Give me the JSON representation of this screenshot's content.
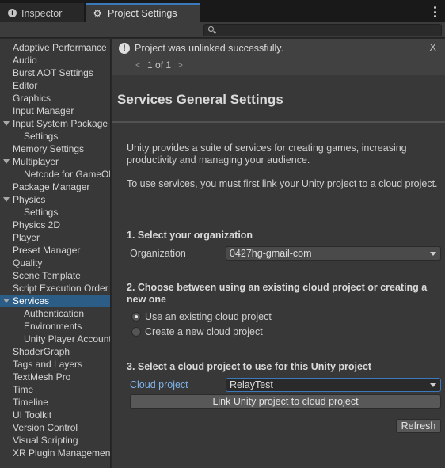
{
  "tabs": {
    "inspector": {
      "label": "Inspector",
      "icon": "info-icon"
    },
    "project_settings": {
      "label": "Project Settings",
      "icon": "gear-icon"
    }
  },
  "toolbar": {
    "search_value": ""
  },
  "sidebar": {
    "items": [
      {
        "label": "Adaptive Performance"
      },
      {
        "label": "Audio"
      },
      {
        "label": "Burst AOT Settings"
      },
      {
        "label": "Editor"
      },
      {
        "label": "Graphics"
      },
      {
        "label": "Input Manager"
      },
      {
        "label": "Input System Package",
        "expanded": true
      },
      {
        "label": "Settings",
        "child": true
      },
      {
        "label": "Memory Settings"
      },
      {
        "label": "Multiplayer",
        "expanded": true
      },
      {
        "label": "Netcode for GameObjects",
        "child": true
      },
      {
        "label": "Package Manager"
      },
      {
        "label": "Physics",
        "expanded": true
      },
      {
        "label": "Settings",
        "child": true
      },
      {
        "label": "Physics 2D"
      },
      {
        "label": "Player"
      },
      {
        "label": "Preset Manager"
      },
      {
        "label": "Quality"
      },
      {
        "label": "Scene Template"
      },
      {
        "label": "Script Execution Order"
      },
      {
        "label": "Services",
        "expanded": true,
        "selected": true
      },
      {
        "label": "Authentication",
        "child": true
      },
      {
        "label": "Environments",
        "child": true
      },
      {
        "label": "Unity Player Accounts",
        "child": true
      },
      {
        "label": "ShaderGraph"
      },
      {
        "label": "Tags and Layers"
      },
      {
        "label": "TextMesh Pro"
      },
      {
        "label": "Time"
      },
      {
        "label": "Timeline"
      },
      {
        "label": "UI Toolkit"
      },
      {
        "label": "Version Control"
      },
      {
        "label": "Visual Scripting"
      },
      {
        "label": "XR Plugin Management"
      }
    ]
  },
  "notification": {
    "message": "Project was unlinked successfully.",
    "close_label": "X",
    "pager_prev": "<",
    "pager_text": "1 of 1",
    "pager_next": ">"
  },
  "main": {
    "title": "Services General Settings",
    "intro_1": "Unity provides a suite of services for creating games, increasing productivity and managing your audience.",
    "intro_2": "To use services, you must first link your Unity project to a cloud project.",
    "step1_heading": "1. Select your organization",
    "org_label": "Organization",
    "org_value": "0427hg-gmail-com",
    "step2_heading": "2. Choose between using an existing cloud project or creating a new one",
    "radio_existing": "Use an existing cloud project",
    "radio_new": "Create a new cloud project",
    "step3_heading": "3. Select a cloud project to use for this Unity project",
    "cloud_label": "Cloud project",
    "cloud_value": "RelayTest",
    "link_button": "Link Unity project to cloud project",
    "refresh_button": "Refresh"
  }
}
